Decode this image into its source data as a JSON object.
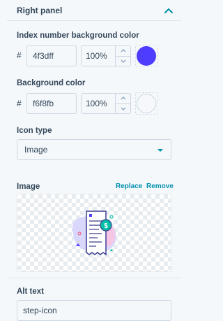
{
  "panel": {
    "title": "Right panel"
  },
  "index_bg": {
    "label": "Index number background color",
    "hash": "#",
    "hex": "4f3dff",
    "opacity": "100%",
    "swatch_color": "#4f3dff"
  },
  "bg": {
    "label": "Background color",
    "hash": "#",
    "hex": "f6f8fb",
    "opacity": "100%",
    "swatch_color": "#f6f8fb"
  },
  "icon_type": {
    "label": "Icon type",
    "selected": "Image"
  },
  "image": {
    "label": "Image",
    "replace_label": "Replace",
    "remove_label": "Remove",
    "icon_name": "receipt-dollar-illustration"
  },
  "alt_text": {
    "label": "Alt text",
    "value": "step-icon"
  },
  "colors": {
    "accent": "#0091ae",
    "border": "#cbd6e2",
    "text": "#33475b",
    "illustration_purple": "#4f3dff",
    "illustration_green": "#00bda5"
  }
}
